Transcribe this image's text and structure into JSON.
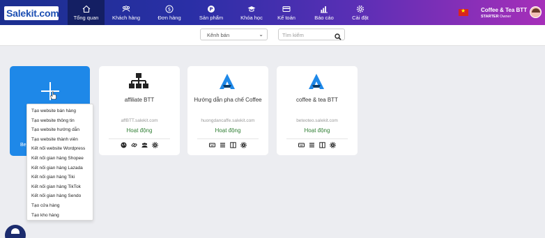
{
  "brand": {
    "logo_text": "Salekit.com"
  },
  "nav": {
    "items": [
      {
        "label": "Tổng quan",
        "icon": "home-icon",
        "active": true
      },
      {
        "label": "Khách hàng",
        "icon": "users-icon"
      },
      {
        "label": "Đơn hàng",
        "icon": "dollar-icon"
      },
      {
        "label": "Sản phẩm",
        "icon": "product-icon"
      },
      {
        "label": "Khóa học",
        "icon": "graduation-cap-icon"
      },
      {
        "label": "Kế toán",
        "icon": "credit-card-icon"
      },
      {
        "label": "Báo cáo",
        "icon": "bar-chart-icon"
      },
      {
        "label": "Cài đặt",
        "icon": "gear-icon"
      }
    ]
  },
  "user": {
    "name": "Coffee & Tea BTT",
    "plan": "STARTER",
    "role": "Owner"
  },
  "filters": {
    "channel_select": "Kênh bán",
    "search_placeholder": "Tìm kiếm"
  },
  "add_card": {
    "label": "Be"
  },
  "cards": [
    {
      "name": "affiliate BTT",
      "domain": "affBTT.salekit.com",
      "status": "Hoạt động",
      "icon": "sitemap-icon",
      "actions": [
        "globe-icon",
        "link-icon",
        "users-icon",
        "gear-icon"
      ]
    },
    {
      "name": "Hướng dẫn pha chế Coffee",
      "domain": "huongdancaffe.salekit.com",
      "status": "Hoạt động",
      "icon": "brand-a-icon",
      "actions": [
        "keyboard-icon",
        "list-icon",
        "columns-icon",
        "gear-icon"
      ]
    },
    {
      "name": "coffee & tea BTT",
      "domain": "beteoteo.salekit.com",
      "status": "Hoạt động",
      "icon": "brand-a-icon",
      "actions": [
        "keyboard-icon",
        "list-icon",
        "columns-icon",
        "gear-icon"
      ]
    }
  ],
  "menu": {
    "items": [
      "Tạo website bán hàng",
      "Tạo website thông tin",
      "Tạo website hướng dẫn",
      "Tạo website thành viên",
      "Kết nối website Wordpress",
      "Kết nối gian hàng Shopee",
      "Kết nối gian hàng Lazada",
      "Kết nối gian hàng Tiki",
      "Kết nối gian hàng TikTok",
      "Kết nối gian hàng Sendo",
      "Tạo cửa hàng",
      "Tạo kho hàng"
    ]
  },
  "colors": {
    "nav_start": "#1b2f8f",
    "nav_end": "#a62fb9",
    "accent": "#1e88e8",
    "status_active": "#2e7d32"
  }
}
